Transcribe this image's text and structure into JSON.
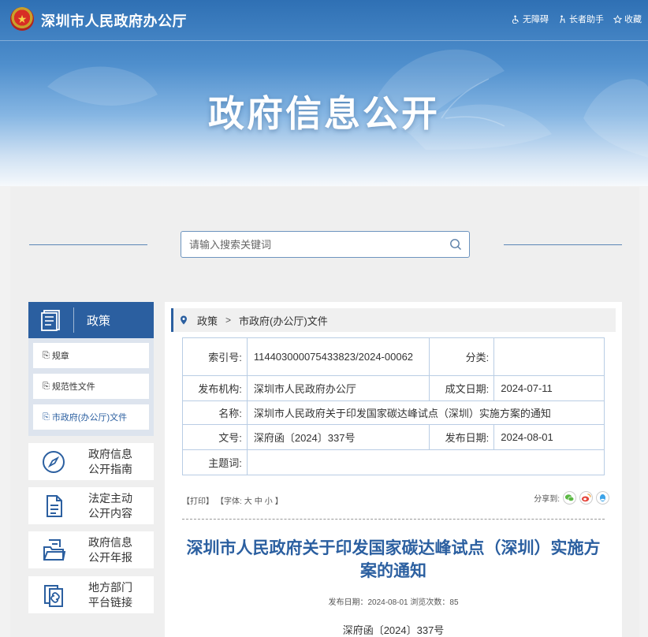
{
  "header": {
    "site_name": "深圳市人民政府办公厅",
    "banner_title": "政府信息公开",
    "tools": [
      {
        "label": "无障碍",
        "icon": "accessibility-icon"
      },
      {
        "label": "长者助手",
        "icon": "elder-icon"
      },
      {
        "label": "收藏",
        "icon": "star-icon"
      }
    ]
  },
  "search": {
    "placeholder": "请输入搜索关键词"
  },
  "sidebar": {
    "heading": "政策",
    "sub_items": [
      {
        "label": "规章"
      },
      {
        "label": "规范性文件"
      },
      {
        "label": "市政府(办公厅)文件"
      }
    ],
    "big_items": [
      {
        "line1": "政府信息",
        "line2": "公开指南",
        "icon": "compass-icon"
      },
      {
        "line1": "法定主动",
        "line2": "公开内容",
        "icon": "document-icon"
      },
      {
        "line1": "政府信息",
        "line2": "公开年报",
        "icon": "folder-report-icon"
      },
      {
        "line1": "地方部门",
        "line2": "平台链接",
        "icon": "link-icon"
      }
    ]
  },
  "breadcrumb": {
    "root": "政策",
    "sep": ">",
    "current": "市政府(办公厅)文件"
  },
  "meta": {
    "index_label": "索引号:",
    "index_value": "114403000075433823/2024-00062",
    "category_label": "分类:",
    "category_value": "",
    "issuer_label": "发布机构:",
    "issuer_value": "深圳市人民政府办公厅",
    "created_label": "成文日期:",
    "created_value": "2024-07-11",
    "name_label": "名称:",
    "name_value": "深圳市人民政府关于印发国家碳达峰试点（深圳）实施方案的通知",
    "docno_label": "文号:",
    "docno_value": "深府函〔2024〕337号",
    "published_label": "发布日期:",
    "published_value": "2024-08-01",
    "subject_label": "主题词:",
    "subject_value": ""
  },
  "utility": {
    "print": "【打印】",
    "font_label": "【字体:",
    "large": "大",
    "medium": "中",
    "small": "小",
    "close": "】"
  },
  "share": {
    "label": "分享到:",
    "icons": [
      "wechat-icon",
      "weibo-icon",
      "qq-icon"
    ]
  },
  "document": {
    "title": "深圳市人民政府关于印发国家碳达峰试点（深圳）实施方案的通知",
    "meta_line": "发布日期：2024-08-01   浏览次数：85",
    "doc_number": "深府函〔2024〕337号"
  },
  "colors": {
    "brand_blue": "#2b5fa0",
    "table_border": "#b9cde4"
  }
}
